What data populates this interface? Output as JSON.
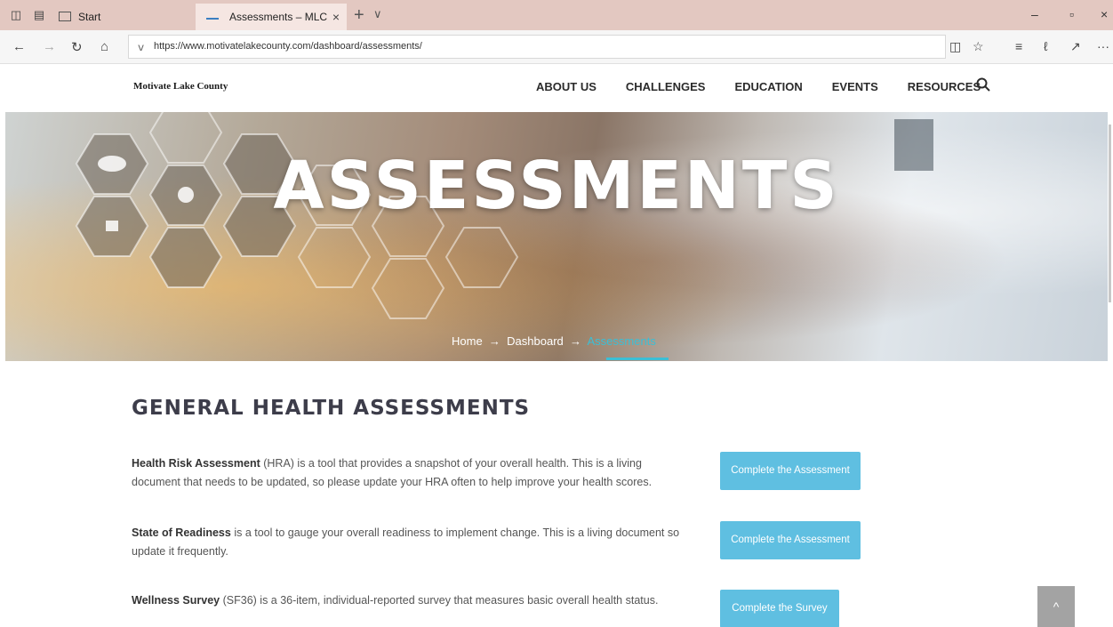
{
  "browser": {
    "tabs": [
      {
        "label": "Start"
      },
      {
        "label": "Assessments – MLC"
      }
    ],
    "new_tab": "+",
    "tab_menu": "∨",
    "close_tab": "×",
    "window": {
      "minimize": "–",
      "restore": "▫",
      "close": "×"
    },
    "url": "https://www.motivatelakecounty.com/dashboard/assessments/",
    "more": "···"
  },
  "site": {
    "logo": "Motivate Lake County",
    "nav": [
      "ABOUT US",
      "CHALLENGES",
      "EDUCATION",
      "EVENTS",
      "RESOURCES"
    ]
  },
  "hero": {
    "title": "ASSESSMENTS",
    "breadcrumb": {
      "home": "Home",
      "sep": "→",
      "dashboard": "Dashboard",
      "current": "Assessments"
    }
  },
  "main": {
    "section_title": "GENERAL HEALTH ASSESSMENTS",
    "items": [
      {
        "name": "Health Risk Assessment",
        "text": " (HRA) is a tool that provides a snapshot of your overall health. This is a living document that needs to be updated, so please update your HRA often to help improve your health scores.",
        "button": "Complete the Assessment"
      },
      {
        "name": "State of Readiness",
        "text": " is a tool to gauge your overall readiness to implement change. This is a living document so update it frequently.",
        "button": "Complete the Assessment"
      },
      {
        "name": "Wellness Survey",
        "text": " (SF36) is a 36-item, individual-reported survey that measures basic overall health status.",
        "button": "Complete the Survey"
      }
    ]
  },
  "colors": {
    "accent": "#5fbfe1",
    "breadcrumb_current": "#3bbfd6",
    "tabbar": "#e3c8c1"
  },
  "icons": [
    "tab-actions-icon",
    "set-aside-icon",
    "back-icon",
    "forward-icon",
    "refresh-icon",
    "home-icon",
    "lock-icon",
    "reading-view-icon",
    "favorite-star-icon",
    "favorites-hub-icon",
    "notes-pen-icon",
    "share-icon",
    "search-icon",
    "chevron-up-icon"
  ],
  "scroll_top_label": "^"
}
